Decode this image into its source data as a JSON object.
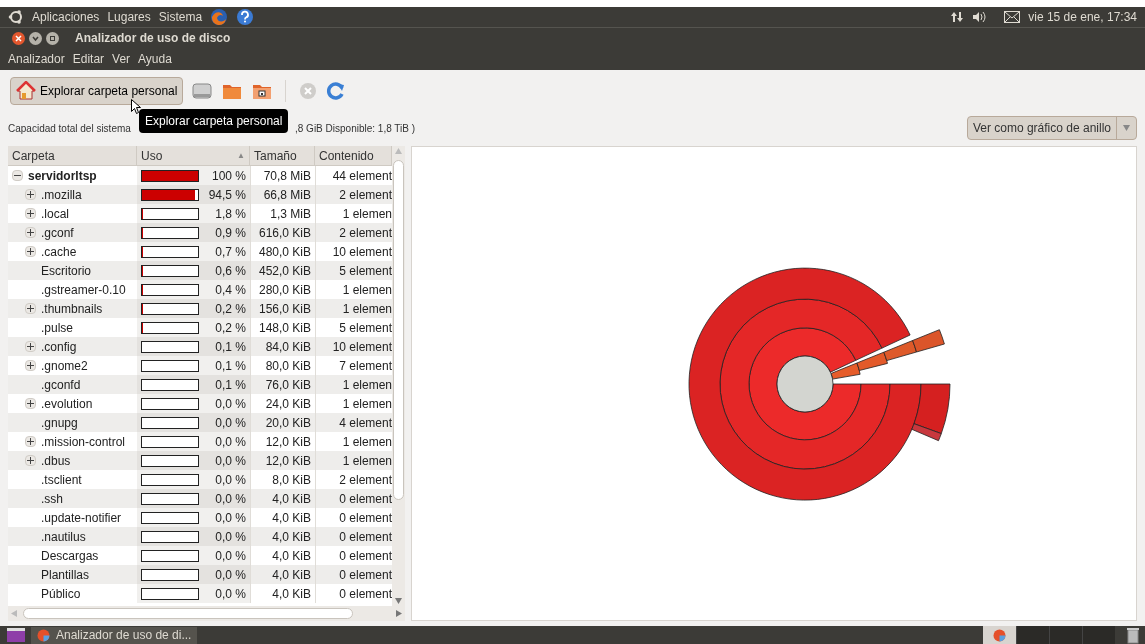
{
  "top_panel": {
    "menus": [
      "Aplicaciones",
      "Lugares",
      "Sistema"
    ],
    "clock": "vie 15 de ene, 17:34"
  },
  "window": {
    "title": "Analizador de uso de disco"
  },
  "menubar": [
    "Analizador",
    "Editar",
    "Ver",
    "Ayuda"
  ],
  "toolbar": {
    "home_button": "Explorar carpeta personal",
    "tooltip": "Explorar carpeta personal"
  },
  "capacity": {
    "left": "Capacidad total del sistema",
    "right": ",8 GiB Disponible: 1,8 TiB )"
  },
  "view_combo": "Ver como gráfico de anillo",
  "tree": {
    "columns": [
      {
        "label": "Carpeta"
      },
      {
        "label": "Uso",
        "sort_indicator": "▲"
      },
      {
        "label": "Tamaño"
      },
      {
        "label": "Contenido"
      }
    ],
    "rows": [
      {
        "name": "servidorltsp",
        "expandable": true,
        "expanded": true,
        "level": 1,
        "percent": "100 %",
        "size": "70,8 MiB",
        "contents": "44 element",
        "children": [
          {
            "name": ".mozilla",
            "expandable": true,
            "expanded": false,
            "level": 0.945,
            "percent": "94,5 %",
            "size": "66,8 MiB",
            "contents": "2 element"
          },
          {
            "name": ".local",
            "expandable": true,
            "expanded": false,
            "level": 0.018,
            "percent": "1,8 %",
            "size": "1,3 MiB",
            "contents": "1 elemen"
          },
          {
            "name": ".gconf",
            "expandable": true,
            "expanded": false,
            "level": 0.009,
            "percent": "0,9 %",
            "size": "616,0 KiB",
            "contents": "2 element"
          },
          {
            "name": ".cache",
            "expandable": true,
            "expanded": false,
            "level": 0.007,
            "percent": "0,7 %",
            "size": "480,0 KiB",
            "contents": "10 element"
          },
          {
            "name": "Escritorio",
            "expandable": false,
            "expanded": false,
            "level": 0.006,
            "percent": "0,6 %",
            "size": "452,0 KiB",
            "contents": "5 element"
          },
          {
            "name": ".gstreamer-0.10",
            "expandable": false,
            "expanded": false,
            "level": 0.004,
            "percent": "0,4 %",
            "size": "280,0 KiB",
            "contents": "1 elemen"
          },
          {
            "name": ".thumbnails",
            "expandable": true,
            "expanded": false,
            "level": 0.002,
            "percent": "0,2 %",
            "size": "156,0 KiB",
            "contents": "1 elemen"
          },
          {
            "name": ".pulse",
            "expandable": false,
            "expanded": false,
            "level": 0.002,
            "percent": "0,2 %",
            "size": "148,0 KiB",
            "contents": "5 element"
          },
          {
            "name": ".config",
            "expandable": true,
            "expanded": false,
            "level": 0.001,
            "percent": "0,1 %",
            "size": "84,0 KiB",
            "contents": "10 element"
          },
          {
            "name": ".gnome2",
            "expandable": true,
            "expanded": false,
            "level": 0.001,
            "percent": "0,1 %",
            "size": "80,0 KiB",
            "contents": "7 element"
          },
          {
            "name": ".gconfd",
            "expandable": false,
            "expanded": false,
            "level": 0.001,
            "percent": "0,1 %",
            "size": "76,0 KiB",
            "contents": "1 elemen"
          },
          {
            "name": ".evolution",
            "expandable": true,
            "expanded": false,
            "level": 0,
            "percent": "0,0 %",
            "size": "24,0 KiB",
            "contents": "1 elemen"
          },
          {
            "name": ".gnupg",
            "expandable": false,
            "expanded": false,
            "level": 0,
            "percent": "0,0 %",
            "size": "20,0 KiB",
            "contents": "4 element"
          },
          {
            "name": ".mission-control",
            "expandable": true,
            "expanded": false,
            "level": 0,
            "percent": "0,0 %",
            "size": "12,0 KiB",
            "contents": "1 elemen"
          },
          {
            "name": ".dbus",
            "expandable": true,
            "expanded": false,
            "level": 0,
            "percent": "0,0 %",
            "size": "12,0 KiB",
            "contents": "1 elemen"
          },
          {
            "name": ".tsclient",
            "expandable": false,
            "expanded": false,
            "level": 0,
            "percent": "0,0 %",
            "size": "8,0 KiB",
            "contents": "2 element"
          },
          {
            "name": ".ssh",
            "expandable": false,
            "expanded": false,
            "level": 0,
            "percent": "0,0 %",
            "size": "4,0 KiB",
            "contents": "0 element"
          },
          {
            "name": ".update-notifier",
            "expandable": false,
            "expanded": false,
            "level": 0,
            "percent": "0,0 %",
            "size": "4,0 KiB",
            "contents": "0 element"
          },
          {
            "name": ".nautilus",
            "expandable": false,
            "expanded": false,
            "level": 0,
            "percent": "0,0 %",
            "size": "4,0 KiB",
            "contents": "0 element"
          },
          {
            "name": "Descargas",
            "expandable": false,
            "expanded": false,
            "level": 0,
            "percent": "0,0 %",
            "size": "4,0 KiB",
            "contents": "0 element"
          },
          {
            "name": "Plantillas",
            "expandable": false,
            "expanded": false,
            "level": 0,
            "percent": "0,0 %",
            "size": "4,0 KiB",
            "contents": "0 element"
          },
          {
            "name": "Público",
            "expandable": false,
            "expanded": false,
            "level": 0,
            "percent": "0,0 %",
            "size": "4,0 KiB",
            "contents": "0 element"
          }
        ]
      }
    ]
  },
  "taskbar": {
    "task": "Analizador de uso de di..."
  }
}
